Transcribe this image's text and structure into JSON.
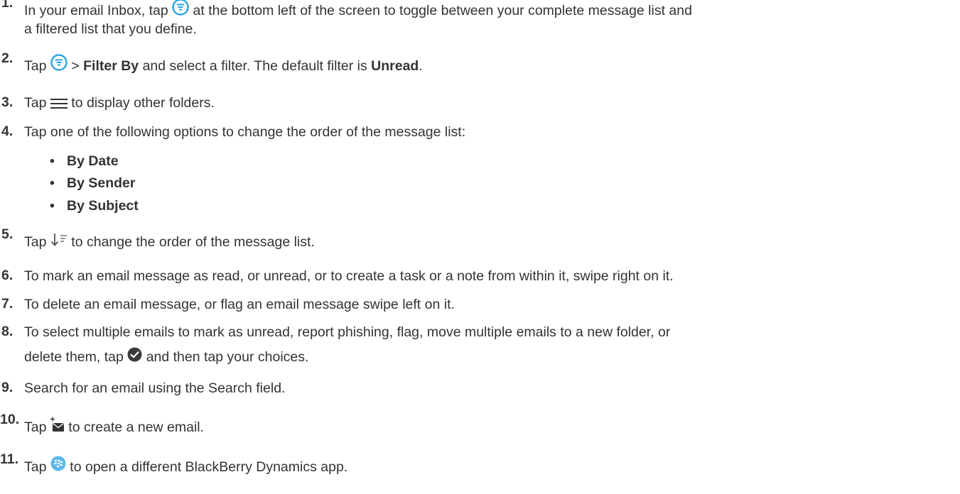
{
  "steps": [
    {
      "num": "1.",
      "pre": "In your email Inbox, tap",
      "post": "at the bottom left of the screen to toggle between your complete message list and",
      "cont": "a filtered list that you define.",
      "icon": "filter-circle-icon"
    },
    {
      "num": "2.",
      "pre": "Tap",
      "mid": ">",
      "bold1": "Filter By",
      "text2": "and select a filter. The default filter is",
      "bold2": "Unread",
      "end": ".",
      "icon": "filter-circle-icon"
    },
    {
      "num": "3.",
      "pre": "Tap",
      "post": "to display other folders.",
      "icon": "hamburger-menu-icon"
    },
    {
      "num": "4.",
      "text": "Tap one of the following options to change the order of the message list:"
    },
    {
      "num": "5.",
      "pre": "Tap",
      "post": "to change the order of the message list.",
      "icon": "sort-order-icon"
    },
    {
      "num": "6.",
      "text": "To mark an email message as read, or unread, or to create a task  or a note from within it, swipe right on it."
    },
    {
      "num": "7.",
      "text": "To delete an email message, or flag an email message swipe left on it."
    },
    {
      "num": "8.",
      "text": "To select multiple emails to mark as unread, report phishing, flag, move multiple emails to a new folder, or",
      "cont_pre": "delete them, tap",
      "cont_post": "and then tap your choices.",
      "icon": "check-circle-icon"
    },
    {
      "num": "9.",
      "text": "Search for an email using the Search field."
    },
    {
      "num": "10.",
      "pre": "Tap",
      "post": "to create a new email.",
      "icon": "compose-email-icon"
    },
    {
      "num": "11.",
      "pre": "Tap",
      "post": "to open a different BlackBerry Dynamics app.",
      "icon": "blackberry-dynamics-icon"
    }
  ],
  "sort_options": [
    "By Date",
    "By Sender",
    "By Subject"
  ],
  "bullet_char": "•",
  "colors": {
    "text": "#333333",
    "filter_icon": "#29A3E0",
    "check_icon": "#3A3A3A",
    "bbd_icon": "#5FB8EA"
  }
}
